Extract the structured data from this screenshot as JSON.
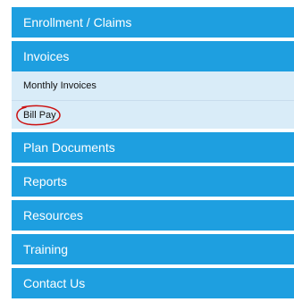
{
  "nav": {
    "enrollment": "Enrollment / Claims",
    "invoices": "Invoices",
    "invoices_sub": {
      "monthly": "Monthly Invoices",
      "bill_pay": "Bill Pay"
    },
    "plan_documents": "Plan Documents",
    "reports": "Reports",
    "resources": "Resources",
    "training": "Training",
    "contact": "Contact Us"
  },
  "colors": {
    "item_bg": "#1e9fe0",
    "sub_bg": "#d9ecf8",
    "annotation": "#cc1111"
  }
}
